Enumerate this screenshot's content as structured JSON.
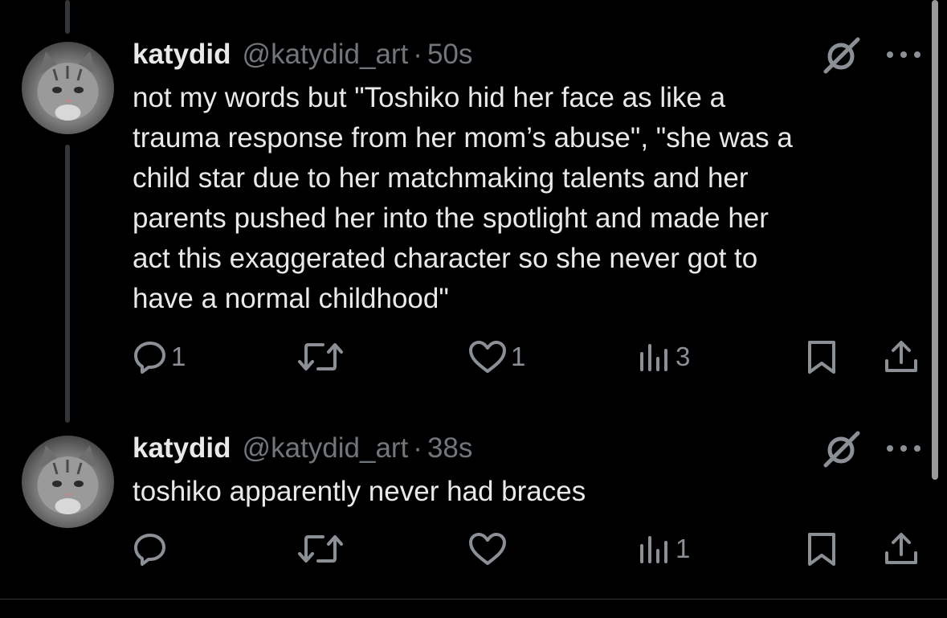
{
  "tweets": [
    {
      "name": "katydid",
      "handle": "@katydid_art",
      "separator": "·",
      "time": "50s",
      "text": "not my words but \"Toshiko hid her face as like a\ntrauma response from her mom’s abuse\", \"she was a\nchild star due to her matchmaking talents and her\nparents pushed her into the spotlight and made her\nact this exaggerated character so she never got to\nhave a normal childhood\"",
      "reply_count": "1",
      "repost_count": "",
      "like_count": "1",
      "view_count": "3"
    },
    {
      "name": "katydid",
      "handle": "@katydid_art",
      "separator": "·",
      "time": "38s",
      "text": "toshiko apparently never had braces",
      "reply_count": "",
      "repost_count": "",
      "like_count": "",
      "view_count": "1"
    }
  ],
  "icons": {
    "avatar": "cat-avatar",
    "grok": "grok-icon",
    "more": "more-icon",
    "reply": "reply-icon",
    "repost": "repost-icon",
    "like": "like-icon",
    "views": "views-icon",
    "bookmark": "bookmark-icon",
    "share": "share-icon"
  },
  "colors": {
    "background": "#000000",
    "primary_text": "#e7e9ea",
    "secondary_text": "#71767b",
    "icon": "#8b9096",
    "thread_line": "#333639"
  }
}
